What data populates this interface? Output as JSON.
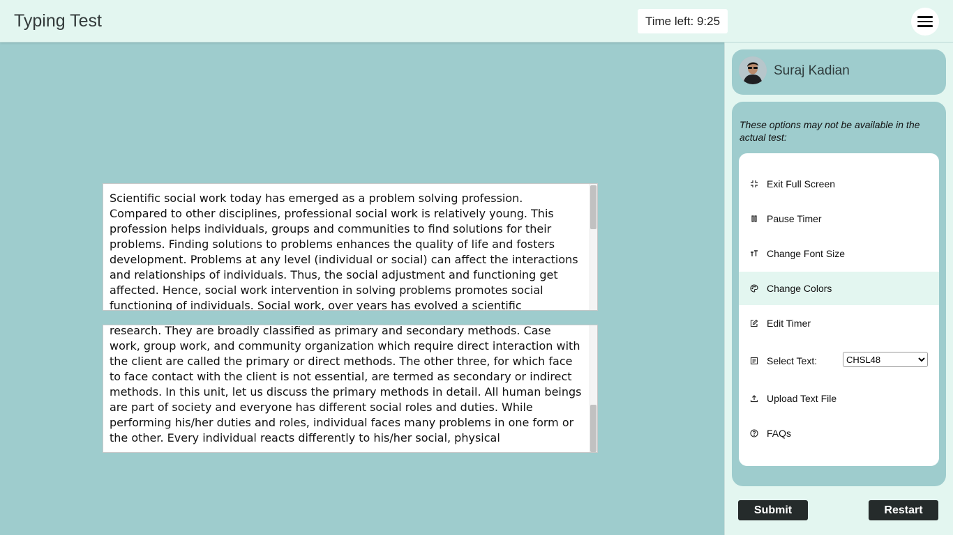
{
  "header": {
    "title": "Typing Test",
    "timer": "Time left: 9:25"
  },
  "reference_text": "Scientific social work today has emerged as a problem solving profession. Compared to other disciplines, professional social work is relatively young. This profession helps individuals, groups and communities to find solutions for their problems. Finding solutions to problems enhances the quality of life and fosters development. Problems at any level (individual or social) can affect the interactions and relationships of individuals. Thus, the social adjustment and functioning get affected. Hence, social work intervention in solving problems promotes social functioning of individuals. Social work, over years has evolved a scientific knowledge base, clear skill sets and a",
  "typed_text": "research. They are broadly classified as primary and secondary methods. Case work, group work, and community organization which require direct interaction with the client are called the primary or direct methods. The other three, for which face to face contact with the client is not essential, are termed as secondary or indirect methods. In this unit, let us discuss the primary methods in detail. All human beings are part of society and everyone has different social roles and duties. While performing his/her duties and roles, individual faces many problems in one form or the other. Every individual reacts differently to his/her social, physical",
  "sidebar": {
    "user_name": "Suraj Kadian",
    "note": "These options may not be available in the actual test:",
    "options": [
      {
        "label": "Exit Full Screen",
        "icon": "exit-fullscreen-icon"
      },
      {
        "label": "Pause Timer",
        "icon": "pause-icon"
      },
      {
        "label": "Change Font Size",
        "icon": "font-size-icon"
      },
      {
        "label": "Change Colors",
        "icon": "palette-icon"
      },
      {
        "label": "Edit Timer",
        "icon": "edit-icon"
      },
      {
        "label": "Select Text:",
        "icon": "text-document-icon"
      },
      {
        "label": "Upload Text File",
        "icon": "upload-icon"
      },
      {
        "label": "FAQs",
        "icon": "help-circle-icon"
      }
    ],
    "select_text_value": "CHSL48"
  },
  "buttons": {
    "submit": "Submit",
    "restart": "Restart"
  },
  "colors": {
    "background": "#9ecccd",
    "header": "#e3f6f0",
    "button": "#252b2b"
  }
}
